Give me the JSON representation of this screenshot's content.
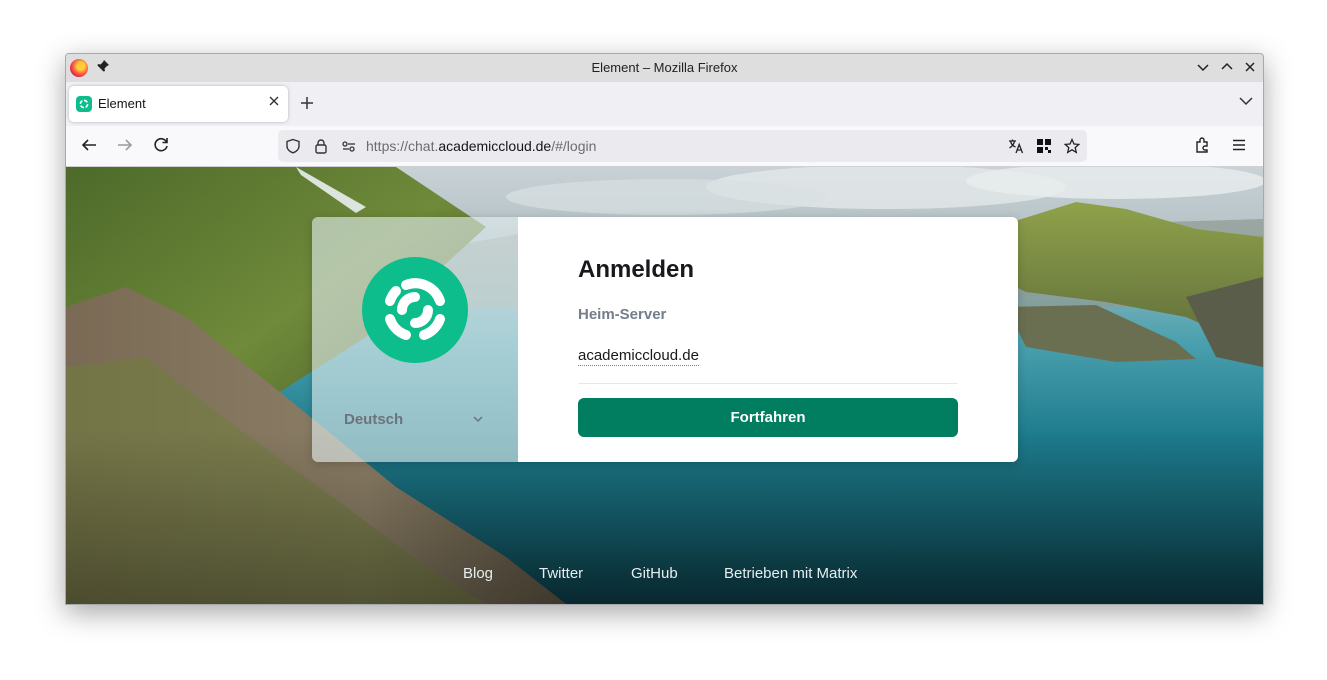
{
  "window": {
    "title": "Element – Mozilla Firefox"
  },
  "tabs": [
    {
      "label": "Element",
      "favicon": "element-favicon"
    }
  ],
  "navbar": {
    "url_prefix": "https://chat.",
    "url_domain": "academiccloud.de",
    "url_suffix": "/#/login"
  },
  "login": {
    "heading": "Anmelden",
    "server_label": "Heim-Server",
    "server_value": "academiccloud.de",
    "continue_label": "Fortfahren",
    "language": "Deutsch"
  },
  "footer": {
    "links": [
      "Blog",
      "Twitter",
      "GitHub",
      "Betrieben mit Matrix"
    ]
  },
  "colors": {
    "accent": "#0dbd8b",
    "button": "#017d5f"
  },
  "icons": [
    "firefox-icon",
    "pin-icon",
    "chevron-down-icon",
    "chevron-up-icon",
    "close-icon",
    "plus-icon",
    "back-icon",
    "forward-icon",
    "reload-icon",
    "shield-icon",
    "lock-icon",
    "permissions-icon",
    "translate-icon",
    "qr-code-icon",
    "star-icon",
    "extensions-icon",
    "menu-icon"
  ]
}
